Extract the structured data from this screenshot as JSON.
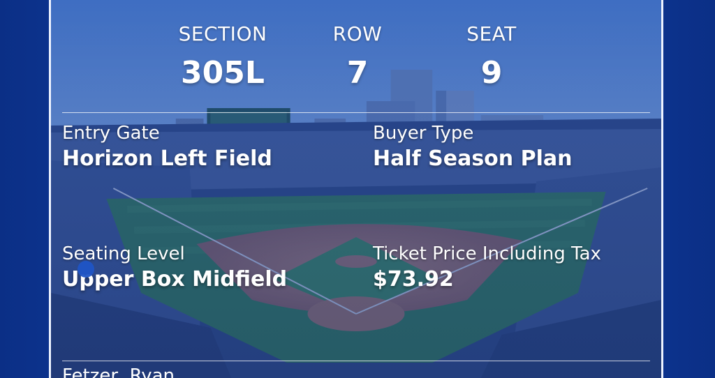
{
  "seat_info": {
    "section_label": "SECTION",
    "section_value": "305L",
    "row_label": "ROW",
    "row_value": "7",
    "seat_label": "SEAT",
    "seat_value": "9"
  },
  "details": {
    "entry_gate_label": "Entry Gate",
    "entry_gate_value": "Horizon Left Field",
    "buyer_type_label": "Buyer Type",
    "buyer_type_value": "Half Season Plan",
    "seating_level_label": "Seating Level",
    "seating_level_value": "Upper Box Midfield",
    "price_label": "Ticket Price Including Tax",
    "price_value": "$73.92"
  },
  "holder": {
    "name": "Fetzer, Ryan"
  },
  "colors": {
    "background": "#0f3a9a",
    "overlay_blue": "#1740a3",
    "text": "#ffffff"
  }
}
